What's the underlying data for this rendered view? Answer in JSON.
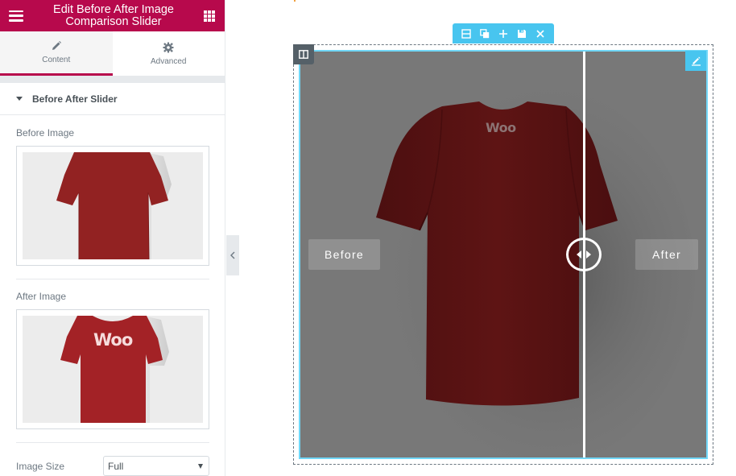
{
  "sidebar": {
    "title_line1": "Edit Before After Image",
    "title_line2": "Comparison Slider",
    "menu_icon": "hamburger-icon",
    "apps_icon": "grid-icon",
    "tabs": [
      {
        "label": "Content",
        "icon": "pencil-icon",
        "active": true
      },
      {
        "label": "Advanced",
        "icon": "gear-icon",
        "active": false
      }
    ],
    "section_title": "Before After Slider",
    "before_image_label": "Before Image",
    "after_image_label": "After Image",
    "image_size_label": "Image Size",
    "image_size_value": "Full",
    "thumb_after_text": "Woo"
  },
  "preview": {
    "toolbar_icons": [
      "edit-section-icon",
      "duplicate-icon",
      "add-icon",
      "save-icon",
      "close-icon"
    ],
    "before_label": "Before",
    "after_label": "After",
    "shirt_text": "Woo",
    "slider_position_percent": 70,
    "colors": {
      "brand": "#b7094c",
      "accent": "#48c5ef",
      "shirt": "#5c1212",
      "background": "#787878"
    }
  }
}
